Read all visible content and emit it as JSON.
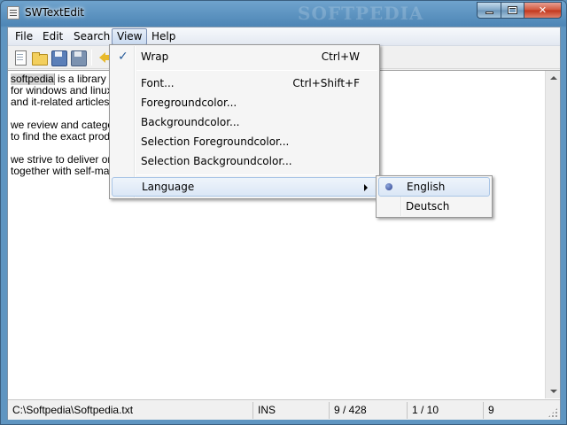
{
  "window": {
    "title": "SWTextEdit",
    "watermark": "SOFTPEDIA"
  },
  "menubar": {
    "items": [
      {
        "label": "File"
      },
      {
        "label": "Edit"
      },
      {
        "label": "Search"
      },
      {
        "label": "View",
        "active": true
      },
      {
        "label": "Help"
      }
    ]
  },
  "toolbar": {
    "icons": [
      "new-file-icon",
      "open-folder-icon",
      "save-icon",
      "save-as-icon",
      "undo-arrow-icon"
    ]
  },
  "editor": {
    "selected_word": "softpedia",
    "lines": [
      " is a library of",
      "for windows and linux, g",
      "and it-related articles.",
      "",
      "we review and categoriz",
      "to find the exact produc",
      "",
      "we strive to deliver only",
      "together with self-made"
    ]
  },
  "view_menu": {
    "items": [
      {
        "label": "Wrap",
        "shortcut": "Ctrl+W",
        "checked": true
      },
      {
        "label": "Font...",
        "shortcut": "Ctrl+Shift+F"
      },
      {
        "label": "Foregroundcolor..."
      },
      {
        "label": "Backgroundcolor..."
      },
      {
        "label": "Selection Foregroundcolor..."
      },
      {
        "label": "Selection Backgroundcolor..."
      },
      {
        "label": "Language",
        "has_submenu": true
      }
    ]
  },
  "language_menu": {
    "items": [
      {
        "label": "English",
        "selected": true
      },
      {
        "label": "Deutsch"
      }
    ]
  },
  "statusbar": {
    "path": "C:\\Softpedia\\Softpedia.txt",
    "mode": "INS",
    "position": "9 / 428",
    "line": "1 / 10",
    "column": "9"
  },
  "colors": {
    "titlebar": "#5f95c1",
    "menu_highlight": "#dbe7f6",
    "check_mark": "#2a5d9a",
    "close_button": "#c2351c"
  }
}
